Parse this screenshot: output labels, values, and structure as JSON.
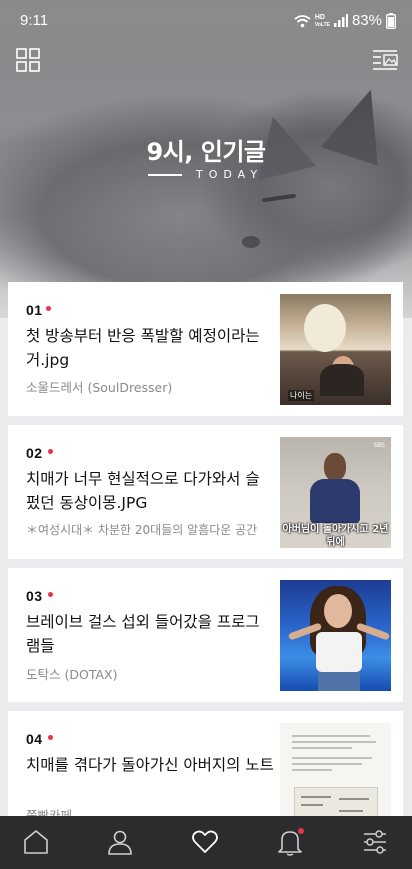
{
  "status_bar": {
    "time": "9:11",
    "network_label_top": "HD",
    "network_label_bottom": "VoLTE",
    "battery": "83%"
  },
  "header": {
    "title": "9시, 인기글",
    "subtitle": "TODAY",
    "left_icon": "grid-icon",
    "right_icon": "gallery-list-icon"
  },
  "posts": [
    {
      "rank": "01",
      "title": "첫 방송부터 반응 폭발할 예정이라는거.jpg",
      "source": "소울드레서 (SoulDresser)",
      "thumb_caption": "나이는"
    },
    {
      "rank": "02",
      "title": "치매가 너무 현실적으로 다가와서 슬펐던 동상이몽.JPG",
      "source": "＊여성시대＊ 차분한 20대들의 알흠다운 공간",
      "thumb_caption": "아버님이 돌아가시고 2년 뒤에",
      "thumb_logo": "SBS"
    },
    {
      "rank": "03",
      "title": "브레이브 걸스 섭외 들어갔을 프로그램들",
      "source": "도탁스 (DOTAX)"
    },
    {
      "rank": "04",
      "title": "치매를 겪다가 돌아가신 아버지의 노트",
      "source": "쭉빵카페"
    }
  ],
  "bottom_nav": [
    {
      "name": "home",
      "icon": "home-icon"
    },
    {
      "name": "profile",
      "icon": "person-icon"
    },
    {
      "name": "favorites",
      "icon": "heart-icon"
    },
    {
      "name": "notifications",
      "icon": "bell-icon",
      "has_badge": true
    },
    {
      "name": "settings",
      "icon": "sliders-icon"
    }
  ],
  "colors": {
    "accent_dot": "#e8334a",
    "nav_background": "#2c2c2f",
    "page_background": "#ececee"
  }
}
